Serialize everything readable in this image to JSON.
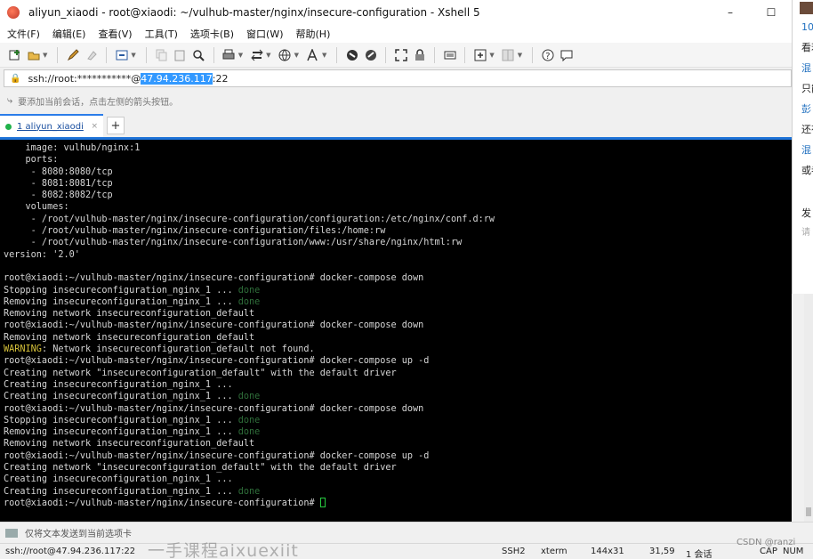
{
  "window": {
    "title": "aliyun_xiaodi - root@xiaodi: ~/vulhub-master/nginx/insecure-configuration - Xshell 5",
    "controls": [
      "–",
      "☐"
    ]
  },
  "menu": [
    "文件(F)",
    "编辑(E)",
    "查看(V)",
    "工具(T)",
    "选项卡(B)",
    "窗口(W)",
    "帮助(H)"
  ],
  "toolbar": {
    "icons": [
      "new-session-icon",
      "open-icon",
      "pen-icon",
      "eraser-icon",
      "transfer-icon",
      "copy-icon",
      "paste-icon",
      "find-icon",
      "print-icon",
      "xftp-icon",
      "globe-icon",
      "font-icon",
      "xshell-logo-icon",
      "xftp-logo-icon",
      "fullscreen-icon",
      "lock-icon",
      "keyboard-icon",
      "add-icon",
      "layout-icon",
      "help-icon",
      "chat-icon"
    ]
  },
  "address": {
    "prefix": "ssh://root:***********@",
    "host": "47.94.236.117",
    "port": ":22"
  },
  "hint": {
    "text": "要添加当前会话，点击左侧的箭头按钮。"
  },
  "tabs": [
    {
      "label": "1 aliyun_xiaodi",
      "close": "×"
    }
  ],
  "tab_add": "+",
  "terminal": {
    "lines": [
      {
        "text": "    image: vulhub/nginx:1"
      },
      {
        "text": "    ports:"
      },
      {
        "text": "     - 8080:8080/tcp"
      },
      {
        "text": "     - 8081:8081/tcp"
      },
      {
        "text": "     - 8082:8082/tcp"
      },
      {
        "text": "    volumes:"
      },
      {
        "text": "     - /root/vulhub-master/nginx/insecure-configuration/configuration:/etc/nginx/conf.d:rw"
      },
      {
        "text": "     - /root/vulhub-master/nginx/insecure-configuration/files:/home:rw"
      },
      {
        "text": "     - /root/vulhub-master/nginx/insecure-configuration/www:/usr/share/nginx/html:rw"
      },
      {
        "text": "version: '2.0'"
      },
      {
        "text": ""
      },
      {
        "text": "root@xiaodi:~/vulhub-master/nginx/insecure-configuration# docker-compose down"
      },
      {
        "text": "Stopping insecureconfiguration_nginx_1 ... ",
        "done": "done"
      },
      {
        "text": "Removing insecureconfiguration_nginx_1 ... ",
        "done": "done"
      },
      {
        "text": "Removing network insecureconfiguration_default"
      },
      {
        "text": "root@xiaodi:~/vulhub-master/nginx/insecure-configuration# docker-compose down"
      },
      {
        "text": "Removing network insecureconfiguration_default"
      },
      {
        "warn": "WARNING",
        "text": ": Network insecureconfiguration_default not found."
      },
      {
        "text": "root@xiaodi:~/vulhub-master/nginx/insecure-configuration# docker-compose up -d"
      },
      {
        "text": "Creating network \"insecureconfiguration_default\" with the default driver"
      },
      {
        "text": "Creating insecureconfiguration_nginx_1 ..."
      },
      {
        "text": "Creating insecureconfiguration_nginx_1 ... ",
        "done": "done"
      },
      {
        "text": "root@xiaodi:~/vulhub-master/nginx/insecure-configuration# docker-compose down"
      },
      {
        "text": "Stopping insecureconfiguration_nginx_1 ... ",
        "done": "done"
      },
      {
        "text": "Removing insecureconfiguration_nginx_1 ... ",
        "done": "done"
      },
      {
        "text": "Removing network insecureconfiguration_default"
      },
      {
        "text": "root@xiaodi:~/vulhub-master/nginx/insecure-configuration# docker-compose up -d"
      },
      {
        "text": "Creating network \"insecureconfiguration_default\" with the default driver"
      },
      {
        "text": "Creating insecureconfiguration_nginx_1 ..."
      },
      {
        "text": "Creating insecureconfiguration_nginx_1 ... ",
        "done": "done"
      },
      {
        "text": "root@xiaodi:~/vulhub-master/nginx/insecure-configuration# ",
        "cursor": true
      }
    ]
  },
  "side_panel": {
    "lines": [
      "10",
      "看若",
      "混",
      "只能",
      "彭",
      "还有",
      "混",
      "或者",
      "发",
      "请"
    ]
  },
  "input_bar": {
    "text": "仅将文本发送到当前选项卡"
  },
  "status": {
    "session": "ssh://root@47.94.236.117:22",
    "protocol": "SSH2",
    "terminal": "xterm",
    "size": "144x31",
    "cursor_pos": "31,59",
    "sessions": "1 会话",
    "caps": "CAP",
    "num": "NUM"
  },
  "watermark": "一手课程aixuexiit",
  "csdn_mark": "CSDN @ranzi"
}
